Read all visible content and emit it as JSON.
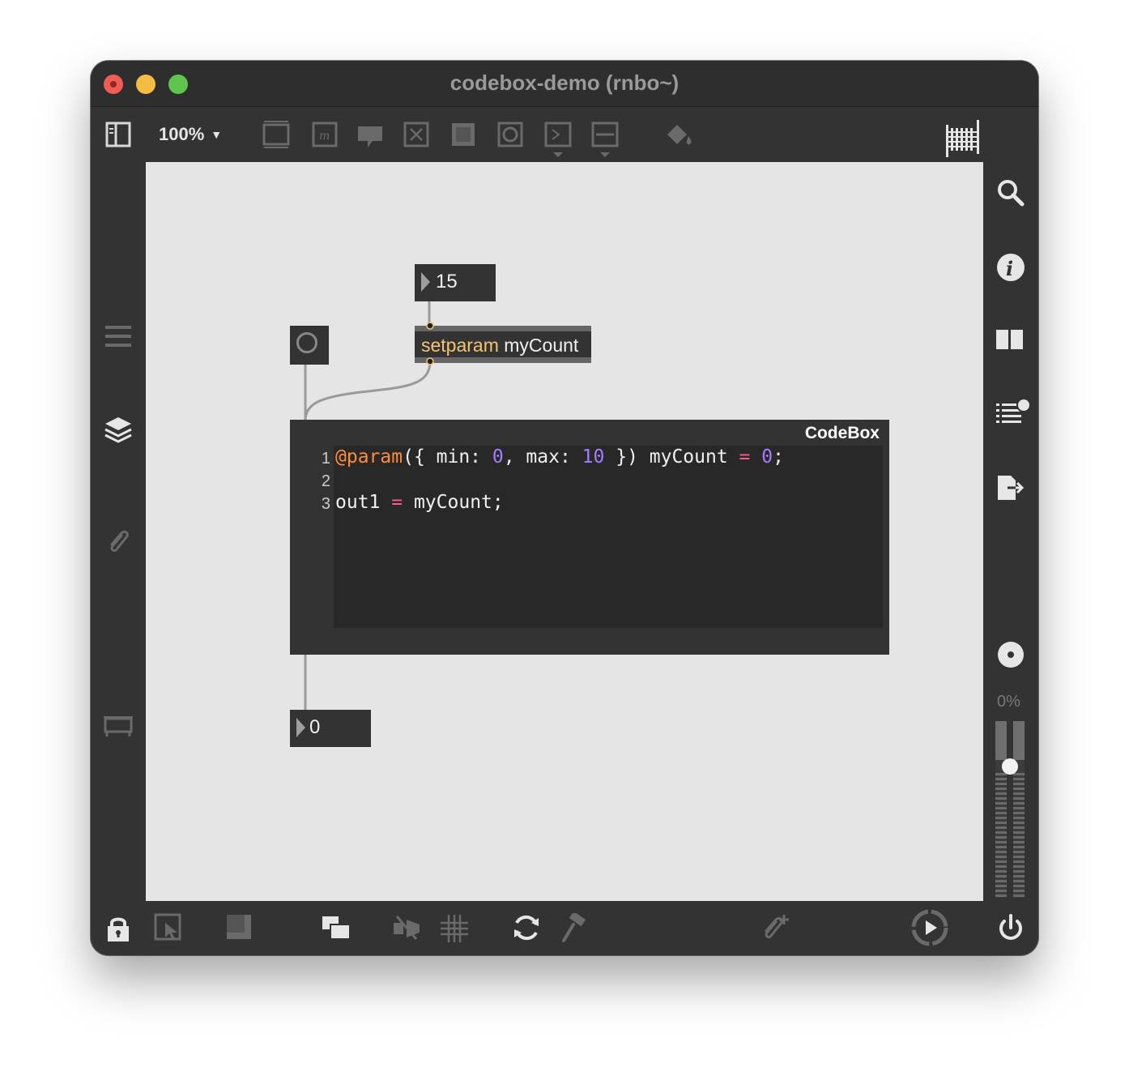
{
  "window": {
    "title": "codebox-demo (rnbo~)"
  },
  "toolbar": {
    "zoom": "100%"
  },
  "patch": {
    "number_top": {
      "value": "15"
    },
    "setparam": {
      "class_name": "setparam",
      "argument": "myCount"
    },
    "codebox": {
      "label": "CodeBox",
      "line_numbers": [
        "1",
        "2",
        "3"
      ],
      "lines": [
        [
          {
            "t": "@param",
            "k": "dec"
          },
          {
            "t": "({ min: ",
            "k": "pl"
          },
          {
            "t": "0",
            "k": "num"
          },
          {
            "t": ", max: ",
            "k": "pl"
          },
          {
            "t": "10",
            "k": "num"
          },
          {
            "t": " }) myCount ",
            "k": "pl"
          },
          {
            "t": "=",
            "k": "op"
          },
          {
            "t": " ",
            "k": "pl"
          },
          {
            "t": "0",
            "k": "num"
          },
          {
            "t": ";",
            "k": "pl"
          }
        ],
        [],
        [
          {
            "t": "out1 ",
            "k": "pl"
          },
          {
            "t": "=",
            "k": "op"
          },
          {
            "t": " myCount;",
            "k": "pl"
          }
        ]
      ]
    },
    "number_bottom": {
      "value": "0"
    }
  },
  "sidebar_right": {
    "cpu_label": "0%"
  },
  "colors": {
    "window_bg": "#333333",
    "canvas_bg": "#e5e5e5",
    "object_bg": "#333333",
    "class_name_color": "#f2c474",
    "decorator_color": "#ff8c3a",
    "number_color": "#a77bff",
    "operator_color": "#ff5a8c"
  }
}
